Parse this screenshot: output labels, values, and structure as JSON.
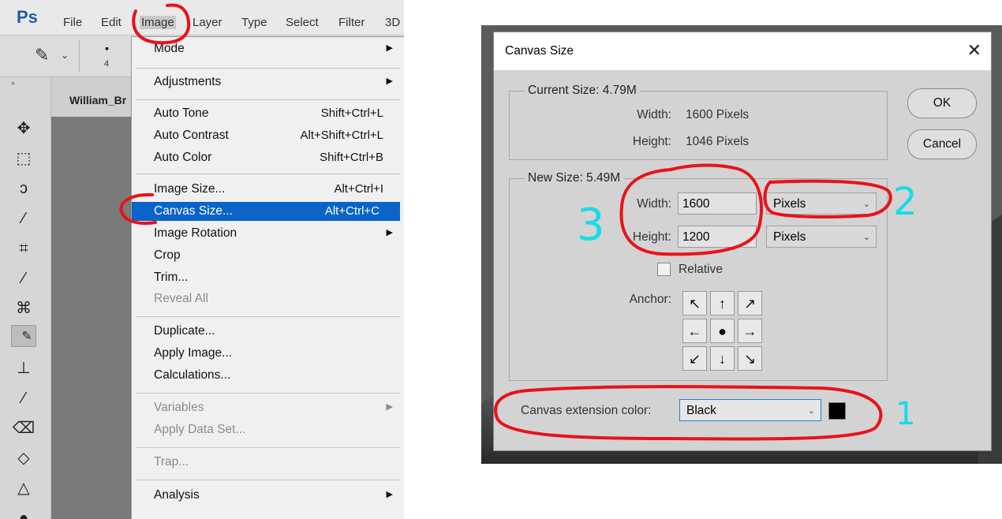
{
  "photoshop": {
    "logo": "Ps",
    "menubar": [
      "File",
      "Edit",
      "Image",
      "Layer",
      "Type",
      "Select",
      "Filter",
      "3D"
    ],
    "brush_size": "4",
    "doc_tab": "William_Br"
  },
  "image_menu": {
    "items": [
      {
        "label": "Mode",
        "shortcut": "",
        "submenu": true,
        "disabled": false
      },
      {
        "label": "Adjustments",
        "shortcut": "",
        "submenu": true,
        "disabled": false
      },
      {
        "label": "Auto Tone",
        "shortcut": "Shift+Ctrl+L",
        "submenu": false,
        "disabled": false
      },
      {
        "label": "Auto Contrast",
        "shortcut": "Alt+Shift+Ctrl+L",
        "submenu": false,
        "disabled": false
      },
      {
        "label": "Auto Color",
        "shortcut": "Shift+Ctrl+B",
        "submenu": false,
        "disabled": false
      },
      {
        "label": "Image Size...",
        "shortcut": "Alt+Ctrl+I",
        "submenu": false,
        "disabled": false
      },
      {
        "label": "Canvas Size...",
        "shortcut": "Alt+Ctrl+C",
        "submenu": false,
        "disabled": false,
        "highlighted": true
      },
      {
        "label": "Image Rotation",
        "shortcut": "",
        "submenu": true,
        "disabled": false
      },
      {
        "label": "Crop",
        "shortcut": "",
        "submenu": false,
        "disabled": false
      },
      {
        "label": "Trim...",
        "shortcut": "",
        "submenu": false,
        "disabled": false
      },
      {
        "label": "Reveal All",
        "shortcut": "",
        "submenu": false,
        "disabled": true
      },
      {
        "label": "Duplicate...",
        "shortcut": "",
        "submenu": false,
        "disabled": false
      },
      {
        "label": "Apply Image...",
        "shortcut": "",
        "submenu": false,
        "disabled": false
      },
      {
        "label": "Calculations...",
        "shortcut": "",
        "submenu": false,
        "disabled": false
      },
      {
        "label": "Variables",
        "shortcut": "",
        "submenu": true,
        "disabled": true
      },
      {
        "label": "Apply Data Set...",
        "shortcut": "",
        "submenu": false,
        "disabled": true
      },
      {
        "label": "Trap...",
        "shortcut": "",
        "submenu": false,
        "disabled": true
      },
      {
        "label": "Analysis",
        "shortcut": "",
        "submenu": true,
        "disabled": false
      }
    ]
  },
  "dialog": {
    "title": "Canvas Size",
    "close": "✕",
    "current_size": {
      "label": "Current Size: 4.79M",
      "width_label": "Width:",
      "width_value": "1600 Pixels",
      "height_label": "Height:",
      "height_value": "1046 Pixels"
    },
    "new_size": {
      "label": "New Size: 5.49M",
      "width_label": "Width:",
      "width_value": "1600",
      "width_unit": "Pixels",
      "height_label": "Height:",
      "height_value": "1200",
      "height_unit": "Pixels",
      "relative_label": "Relative",
      "anchor_label": "Anchor:"
    },
    "ok_label": "OK",
    "cancel_label": "Cancel",
    "extension_color_label": "Canvas extension color:",
    "extension_color_value": "Black",
    "extension_swatch_color": "#000000"
  },
  "annotations": {
    "one": "1",
    "two": "2",
    "three": "3",
    "ink_color": "#e8131a",
    "number_color": "#19dbe6"
  }
}
